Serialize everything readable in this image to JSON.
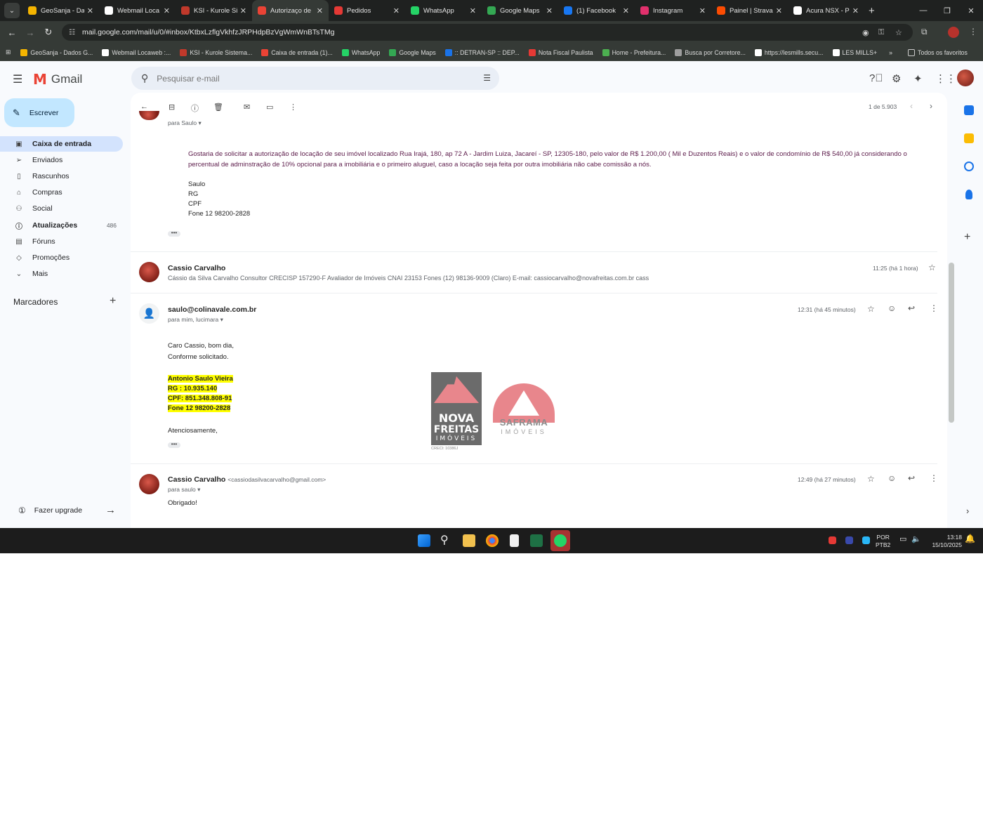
{
  "browser": {
    "tabs": [
      {
        "label": "GeoSanja - Da",
        "color": "#f4b400"
      },
      {
        "label": "Webmail Loca",
        "color": "#ffffff"
      },
      {
        "label": "KSI - Kurole Si",
        "color": "#c0392b"
      },
      {
        "label": "Autorizaço de",
        "color": "#ea4335"
      },
      {
        "label": "Pedidos",
        "color": "#e53935"
      },
      {
        "label": "WhatsApp",
        "color": "#25d366"
      },
      {
        "label": "Google Maps",
        "color": "#34a853"
      },
      {
        "label": "(1) Facebook",
        "color": "#1877f2"
      },
      {
        "label": "Instagram",
        "color": "#e1306c"
      },
      {
        "label": "Painel | Strava",
        "color": "#fc4c02"
      },
      {
        "label": "Acura NSX - Pe",
        "color": "#ffffff"
      }
    ],
    "url": "mail.google.com/mail/u/0/#inbox/KtbxLzflgVkhfzJRPHdpBzVgWmWnBTsTMg",
    "bookmarks": [
      {
        "label": "GeoSanja - Dados G...",
        "color": "#f4b400"
      },
      {
        "label": "Webmail Locaweb :...",
        "color": "#ffffff"
      },
      {
        "label": "KSI - Kurole Sistema...",
        "color": "#c0392b"
      },
      {
        "label": "Caixa de entrada (1)...",
        "color": "#ea4335"
      },
      {
        "label": "WhatsApp",
        "color": "#25d366"
      },
      {
        "label": "Google Maps",
        "color": "#34a853"
      },
      {
        "label": ":: DETRAN-SP :: DEP...",
        "color": "#1a73e8"
      },
      {
        "label": "Nota Fiscal Paulista",
        "color": "#e53935"
      },
      {
        "label": "Home - Prefeitura...",
        "color": "#4caf50"
      },
      {
        "label": "Busca por Corretore...",
        "color": "#9e9e9e"
      },
      {
        "label": "https://lesmills.secu...",
        "color": "#ffffff"
      },
      {
        "label": "LES MILLS+",
        "color": "#ffffff"
      }
    ],
    "bookmarks_more": "»",
    "all_bookmarks": "Todos os favoritos"
  },
  "gmail": {
    "app_name": "Gmail",
    "search_placeholder": "Pesquisar e-mail",
    "compose_label": "Escrever",
    "nav": [
      {
        "label": "Caixa de entrada",
        "icon": "inbox-icon",
        "glyph": "▣",
        "count": ""
      },
      {
        "label": "Enviados",
        "icon": "send-icon",
        "glyph": "➢",
        "count": ""
      },
      {
        "label": "Rascunhos",
        "icon": "draft-icon",
        "glyph": "▯",
        "count": ""
      },
      {
        "label": "Compras",
        "icon": "shopping-icon",
        "glyph": "⌂",
        "count": ""
      },
      {
        "label": "Social",
        "icon": "people-icon",
        "glyph": "⚇",
        "count": ""
      },
      {
        "label": "Atualizações",
        "icon": "info-icon",
        "glyph": "ⓘ",
        "count": "486"
      },
      {
        "label": "Fóruns",
        "icon": "forum-icon",
        "glyph": "▤",
        "count": ""
      },
      {
        "label": "Promoções",
        "icon": "tag-icon",
        "glyph": "◇",
        "count": ""
      },
      {
        "label": "Mais",
        "icon": "chevron-down-icon",
        "glyph": "⌄",
        "count": ""
      }
    ],
    "labels_header": "Marcadores",
    "upgrade": "Fazer upgrade",
    "pager": "1 de 5.903"
  },
  "thread": {
    "msg1": {
      "to": "para Saulo",
      "body": "Gostaria de solicitar a autorização de locação de seu imóvel localizado Rua  Irajá, 180, ap 72 A - Jardim Luiza, Jacareí - SP, 12305-180, pelo valor de R$ 1.200,00 ( Mil e Duzentos Reais) e o valor de condomínio de R$ 540,00  já considerando o percentual de  adminstração de 10% opcional para a imobiliária e o primeiro aluguel, caso a locação seja feita por outra imobiliária não cabe comissão a nós.",
      "sig": [
        "Saulo",
        "RG",
        "CPF",
        "Fone 12 98200-2828"
      ]
    },
    "msg2": {
      "sender": "Cassio Carvalho",
      "time": "11:25 (há 1 hora)",
      "snippet": "Cássio da Silva Carvalho Consultor CRECISP 157290-F Avaliador de Imóveis CNAI 23153 Fones (12) 98136-9009 (Claro) E-mail: cassiocarvalho@novafreitas.com.br cass"
    },
    "msg3": {
      "sender": "saulo@colinavale.com.br",
      "to": "para mim, lucimara",
      "time": "12:31 (há 45 minutos)",
      "lines": [
        "Caro Cassio, bom dia,",
        "Conforme solicitado."
      ],
      "highlight": [
        "Antonio Saulo Vieira",
        "RG : 10.935.140",
        "CPF: 851.348.808-91",
        "Fone 12 98200-2828"
      ],
      "closing": "Atenciosamente,",
      "logo_nova": [
        "NOVA",
        "FREITAS",
        "IMÓVEIS"
      ],
      "crec": "CRECI: 10386J",
      "logo_saf": [
        "SAFRAMA",
        "IMÓVEIS"
      ]
    },
    "msg4": {
      "sender": "Cassio Carvalho",
      "email": "<cassiodasilvacarvalho@gmail.com>",
      "to": "para saulo",
      "time": "12:49 (há 27 minutos)",
      "body": "Obrigado!"
    }
  },
  "taskbar": {
    "lang": "POR",
    "layout": "PTB2",
    "time": "13:18",
    "date": "15/10/2025"
  }
}
